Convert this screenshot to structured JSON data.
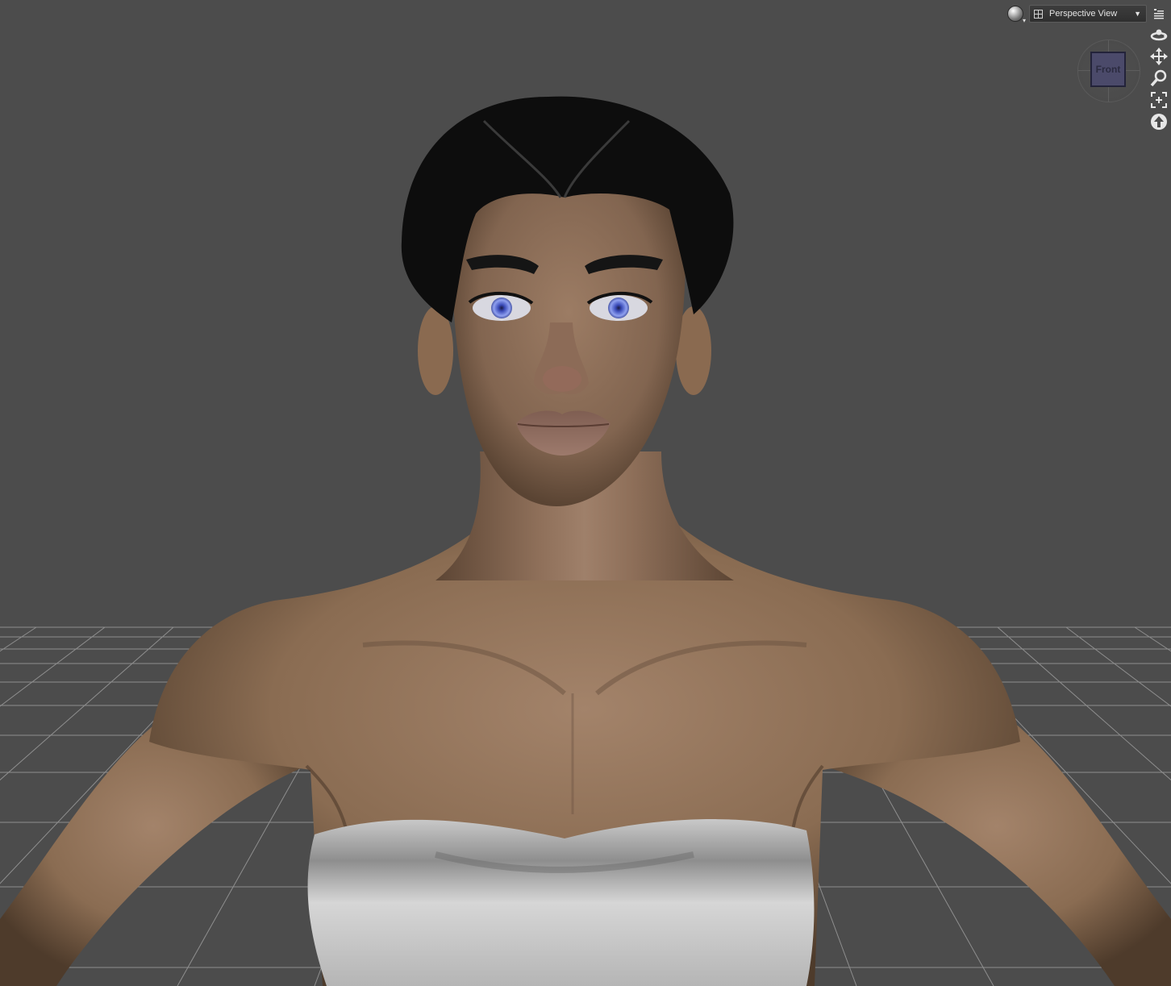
{
  "viewport": {
    "camera_label": "Perspective View",
    "nav_cube_face": "Front",
    "colors": {
      "background": "#4c4c4c",
      "grid_line": "#9a9a9a",
      "skin": "#8a6c52",
      "hair": "#0d0d0d",
      "iris": "#6f7fe0",
      "garment": "#cfcfcf"
    }
  },
  "toolbar": {
    "render_style_icon": "sphere-icon",
    "camera_icon": "camera-grid-icon",
    "options_icon": "menu-lines-icon"
  },
  "nav_tools": [
    {
      "name": "orbit-icon"
    },
    {
      "name": "pan-icon"
    },
    {
      "name": "zoom-icon"
    },
    {
      "name": "frame-icon"
    },
    {
      "name": "reset-view-icon"
    }
  ]
}
